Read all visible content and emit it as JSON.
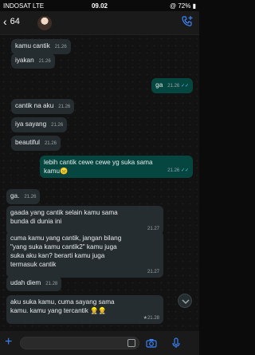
{
  "status": {
    "carrier": "INDOSAT LTE",
    "time": "09.02",
    "battery": "72%"
  },
  "header": {
    "back_count": "64"
  },
  "messages": [
    {
      "dir": "in",
      "text": "kamu cantik",
      "time": "21.26"
    },
    {
      "dir": "in",
      "text": "iyakan",
      "time": "21.26"
    },
    {
      "dir": "out",
      "text": "ga",
      "time": "21.26"
    },
    {
      "dir": "in",
      "text": "cantik na aku",
      "time": "21.26"
    },
    {
      "dir": "in",
      "text": "iya sayang",
      "time": "21.26"
    },
    {
      "dir": "in",
      "text": "beautiful",
      "time": "21.26"
    },
    {
      "dir": "out",
      "lines": [
        "lebih cantik cewe cewe yg suka sama",
        "kamu😑"
      ],
      "time": "21.26"
    },
    {
      "dir": "in",
      "text": "ga.",
      "time": "21.26"
    },
    {
      "dir": "in",
      "lines": [
        "gaada yang cantik selain kamu sama",
        "bunda di dunia ini"
      ],
      "time": "21.27"
    },
    {
      "dir": "in",
      "lines": [
        "cuma kamu yang cantik, jangan bilang",
        "\"yang suka kamu cantik2\" kamu juga",
        "suka aku kan? berarti kamu juga",
        "termasuk cantik"
      ],
      "time": "21.27"
    },
    {
      "dir": "in",
      "text": "udah diem",
      "time": "21.28"
    },
    {
      "dir": "in",
      "lines": [
        "aku suka kamu, cuma sayang sama",
        "kamu. kamu yang tercantik 👷👷"
      ],
      "time": "★21.28"
    }
  ],
  "colors": {
    "accent": "#3b82f6",
    "incoming": "#262d31",
    "outgoing": "#054740",
    "read_ticks": "#53bdeb"
  }
}
